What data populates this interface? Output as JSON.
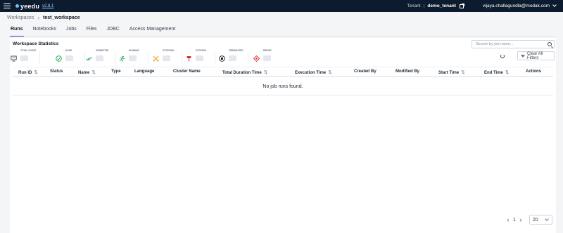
{
  "app": {
    "brand": "yeedu",
    "version": "v2.8.1",
    "tenant_label": "Tenant",
    "tenant_separator": "|",
    "tenant_name": "demo_tenant",
    "user_email": "vijaya.challagundla@modak.com"
  },
  "breadcrumb": {
    "parent": "Workspaces",
    "current": "test_workspace"
  },
  "tabs": [
    {
      "label": "Runs",
      "active": true
    },
    {
      "label": "Notebooks",
      "active": false
    },
    {
      "label": "Jobs",
      "active": false
    },
    {
      "label": "Files",
      "active": false
    },
    {
      "label": "JDBC",
      "active": false
    },
    {
      "label": "Access Management",
      "active": false
    }
  ],
  "statistics": {
    "title": "Workspace Statistics",
    "items": [
      {
        "label": "TOTAL COUNT",
        "icon": "monitor-icon",
        "color": "#374151"
      },
      {
        "label": "DONE",
        "icon": "check-circle-icon",
        "color": "#16a34a"
      },
      {
        "label": "SUBMITTED",
        "icon": "double-check-icon",
        "color": "#16a34a"
      },
      {
        "label": "RUNNING",
        "icon": "running-icon",
        "color": "#16a34a"
      },
      {
        "label": "STOPPING",
        "icon": "stopping-icon",
        "color": "#f59e0b"
      },
      {
        "label": "STOPPED",
        "icon": "stopped-icon",
        "color": "#dc2626"
      },
      {
        "label": "TERMINATED",
        "icon": "stop-circle-icon",
        "color": "#111827"
      },
      {
        "label": "ERROR",
        "icon": "error-diamond-icon",
        "color": "#dc2626"
      }
    ]
  },
  "search": {
    "placeholder": "Search by job name..."
  },
  "clear_filters_label": "Clear All Filters",
  "table": {
    "columns": [
      {
        "label": "Run ID",
        "sortable": true
      },
      {
        "label": "Status",
        "sortable": false
      },
      {
        "label": "Name",
        "sortable": true
      },
      {
        "label": "Type",
        "sortable": false
      },
      {
        "label": "Language",
        "sortable": false
      },
      {
        "label": "Cluster Name",
        "sortable": false
      },
      {
        "label": "Total Duration Time",
        "sortable": true
      },
      {
        "label": "Execution Time",
        "sortable": true
      },
      {
        "label": "Created By",
        "sortable": false
      },
      {
        "label": "Modified By",
        "sortable": false
      },
      {
        "label": "Start Time",
        "sortable": true
      },
      {
        "label": "End Time",
        "sortable": true
      },
      {
        "label": "Actions",
        "sortable": false
      }
    ],
    "empty_message": "No job runs found."
  },
  "pagination": {
    "current_page": "1",
    "page_size": "20"
  },
  "colors": {
    "topbar": "#0d1b2e",
    "accent": "#1f4fb5"
  }
}
